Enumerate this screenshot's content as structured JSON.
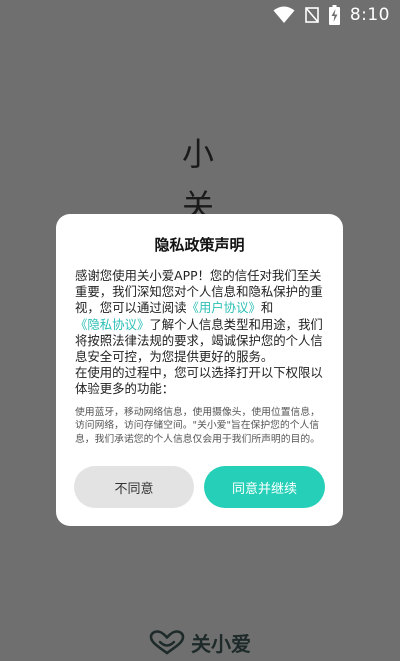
{
  "status_bar": {
    "time": "8:10"
  },
  "background": {
    "app_title_line1": "小",
    "app_title_line2": "关"
  },
  "dialog": {
    "title": "隐私政策声明",
    "body_part1": "感谢您使用关小爱APP！您的信任对我们至关重要，我们深知您对个人信息和隐私保护的重视，您可以通过阅读",
    "user_agreement_link": "《用户协议》",
    "body_and": "和",
    "privacy_link": "《隐私协议》",
    "body_part2": "了解个人信息类型和用途，我们将按照法律法规的要求，竭诚保护您的个人信息安全可控，为您提供更好的服务。",
    "body_part3": "在使用的过程中，您可以选择打开以下权限以体验更多的功能：",
    "permissions_text": "使用蓝牙，移动网络信息，使用摄像头，使用位置信息，访问网络，访问存储空间。\"关小爱\"旨在保护您的个人信息，我们承诺您的个人信息仅会用于我们所声明的目的。",
    "decline_label": "不同意",
    "agree_label": "同意并继续"
  },
  "brand": {
    "name": "关小爱",
    "icon": "heart-logo-icon"
  },
  "colors": {
    "accent": "#26d0b8",
    "link": "#2bbfb5",
    "overlay": "#6f6f6f"
  }
}
